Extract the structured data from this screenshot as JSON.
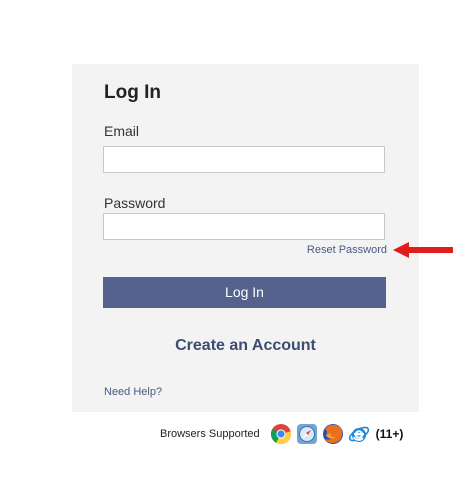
{
  "login": {
    "title": "Log In",
    "email_label": "Email",
    "email_value": "",
    "password_label": "Password",
    "password_value": "",
    "reset_password": "Reset Password",
    "login_button": "Log In",
    "create_account": "Create an Account",
    "need_help": "Need Help?"
  },
  "browsers": {
    "label": "Browsers Supported",
    "icons": [
      "chrome-icon",
      "safari-icon",
      "firefox-icon",
      "internet-explorer-icon"
    ],
    "ie_version": "(11+)"
  },
  "annotation": {
    "arrow_color": "#e21b1b"
  },
  "colors": {
    "button": "#56628e",
    "link": "#4a5a85",
    "card_bg": "#f3f3f3"
  }
}
